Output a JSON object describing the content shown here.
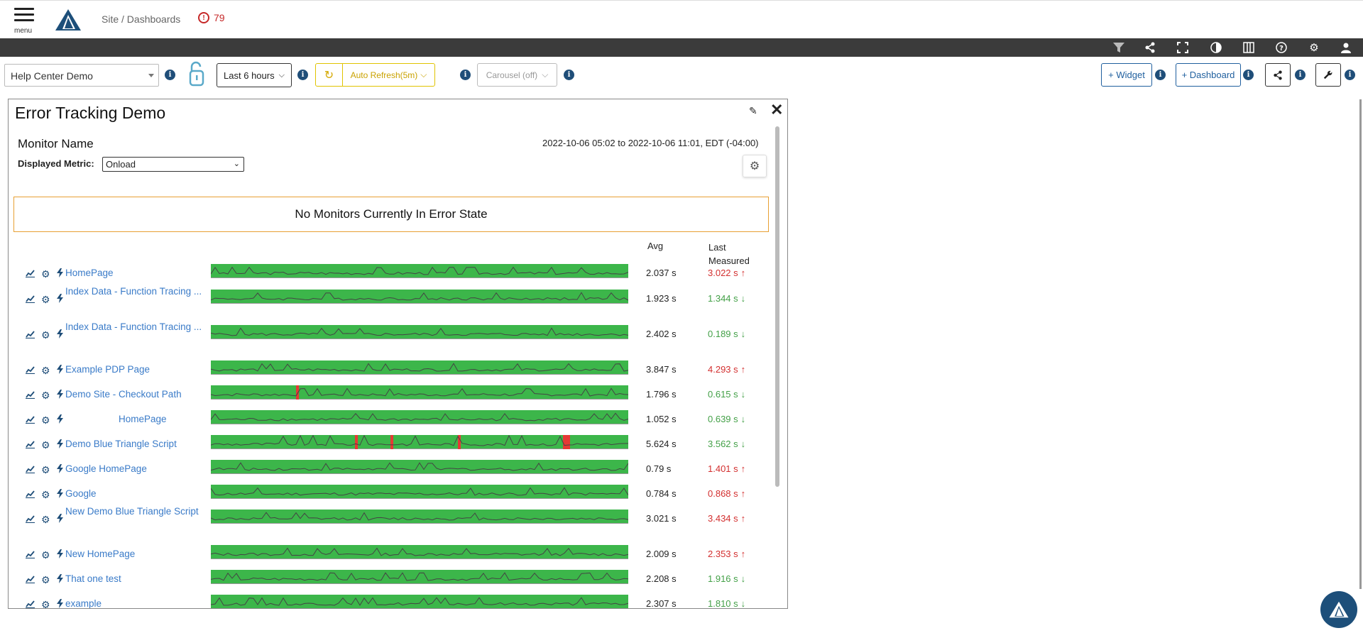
{
  "header": {
    "menu_label": "menu",
    "breadcrumb": "Site / Dashboards",
    "alert_count": "79",
    "alert_icon": "!"
  },
  "toolbar": {
    "site_select": "Help Center Demo",
    "time_range": "Last 6 hours",
    "auto_refresh": "Auto Refresh(5m)",
    "carousel": "Carousel (off)",
    "add_widget": "+ Widget",
    "add_dashboard": "+ Dashboard",
    "info_glyph": "i"
  },
  "widget": {
    "title": "Error Tracking Demo",
    "monitor_name_label": "Monitor Name",
    "date_range": "2022-10-06 05:02 to 2022-10-06 11:01, EDT (-04:00)",
    "displayed_metric_label": "Displayed Metric:",
    "displayed_metric_value": "Onload",
    "error_message": "No Monitors Currently In Error State",
    "col_avg": "Avg",
    "col_last_1": "Last",
    "col_last_2": "Measured",
    "rows": [
      {
        "name": "HomePage",
        "avg": "2.037 s",
        "last": "3.022 s",
        "trend": "up"
      },
      {
        "name": "Index Data - Function Tracing ...",
        "avg": "1.923 s",
        "last": "1.344 s",
        "trend": "down"
      },
      {
        "name": "Index Data - Function Tracing ...",
        "avg": "2.402 s",
        "last": "0.189 s",
        "trend": "down"
      },
      {
        "name": "Example PDP Page",
        "avg": "3.847 s",
        "last": "4.293 s",
        "trend": "up"
      },
      {
        "name": "Demo Site - Checkout Path",
        "avg": "1.796 s",
        "last": "0.615 s",
        "trend": "down"
      },
      {
        "name": "HomePage",
        "avg": "1.052 s",
        "last": "0.639 s",
        "trend": "down"
      },
      {
        "name": "Demo Blue Triangle Script",
        "avg": "5.624 s",
        "last": "3.562 s",
        "trend": "down"
      },
      {
        "name": "Google HomePage",
        "avg": "0.79 s",
        "last": "1.401 s",
        "trend": "up"
      },
      {
        "name": "Google",
        "avg": "0.784 s",
        "last": "0.868 s",
        "trend": "up"
      },
      {
        "name": "New Demo Blue Triangle Script",
        "avg": "3.021 s",
        "last": "3.434 s",
        "trend": "up"
      },
      {
        "name": "New HomePage",
        "avg": "2.009 s",
        "last": "2.353 s",
        "trend": "up"
      },
      {
        "name": "That one test",
        "avg": "2.208 s",
        "last": "1.916 s",
        "trend": "down"
      },
      {
        "name": "example",
        "avg": "2.307 s",
        "last": "1.810 s",
        "trend": "down"
      }
    ]
  },
  "colors": {
    "accent_blue": "#1f5f9e",
    "spark_green": "#3cb64a",
    "error_red": "#d32f2f",
    "ok_green": "#43a047",
    "refresh_yellow": "#e0c300",
    "alert_red": "#c62828",
    "dark_bar": "#3b3b3b"
  },
  "icons": {
    "trend": "chart-line-icon",
    "gear": "gear-icon",
    "bolt": "bolt-icon",
    "up": "arrow-up-icon",
    "down": "arrow-down-icon"
  }
}
